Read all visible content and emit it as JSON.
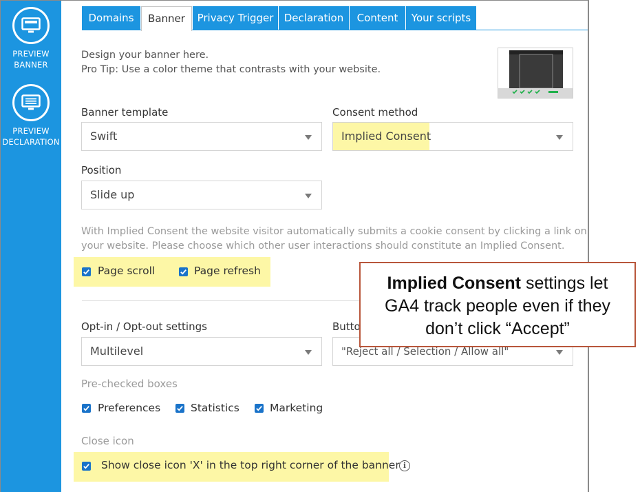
{
  "sidebar": {
    "preview_banner": [
      "PREVIEW",
      "BANNER"
    ],
    "preview_declaration": [
      "PREVIEW",
      "DECLARATION"
    ]
  },
  "tabs": [
    {
      "label": "Domains"
    },
    {
      "label": "Banner",
      "active": true
    },
    {
      "label": "Privacy Trigger"
    },
    {
      "label": "Declaration"
    },
    {
      "label": "Content"
    },
    {
      "label": "Your scripts"
    }
  ],
  "intro": {
    "line1": "Design your banner here.",
    "line2": "Pro Tip: Use a color theme that contrasts with your website."
  },
  "banner_template": {
    "label": "Banner template",
    "value": "Swift"
  },
  "consent_method": {
    "label": "Consent method",
    "value": "Implied Consent"
  },
  "position": {
    "label": "Position",
    "value": "Slide up"
  },
  "implied_help": {
    "line1": "With Implied Consent the website visitor automatically submits a cookie consent by clicking a link on",
    "line2": "your website. Please choose which other user interactions should constitute an Implied Consent."
  },
  "implied_checks": [
    {
      "label": "Page scroll",
      "checked": true
    },
    {
      "label": "Page refresh",
      "checked": true
    }
  ],
  "optin": {
    "label": "Opt-in / Opt-out settings",
    "value": "Multilevel"
  },
  "buttons": {
    "label": "Butto",
    "value": "\"Reject all / Selection / Allow all\""
  },
  "prechecked": {
    "label": "Pre-checked boxes",
    "items": [
      {
        "label": "Preferences",
        "checked": true
      },
      {
        "label": "Statistics",
        "checked": true
      },
      {
        "label": "Marketing",
        "checked": true
      }
    ]
  },
  "close_icon": {
    "label": "Close icon",
    "option": {
      "label": "Show close icon 'X' in the top right corner of the banner",
      "checked": true
    },
    "info_glyph": "i"
  },
  "callout": {
    "bold": "Implied Consent",
    "rest1": " settings let",
    "line2": "GA4 track people even if they",
    "line3": "don’t click “Accept”"
  },
  "colors": {
    "accent": "#1c95e0",
    "highlight": "#fdf7a6",
    "checkbox": "#1a73c9",
    "callout_border": "#b8563b",
    "thumb_green": "#22b14c"
  }
}
